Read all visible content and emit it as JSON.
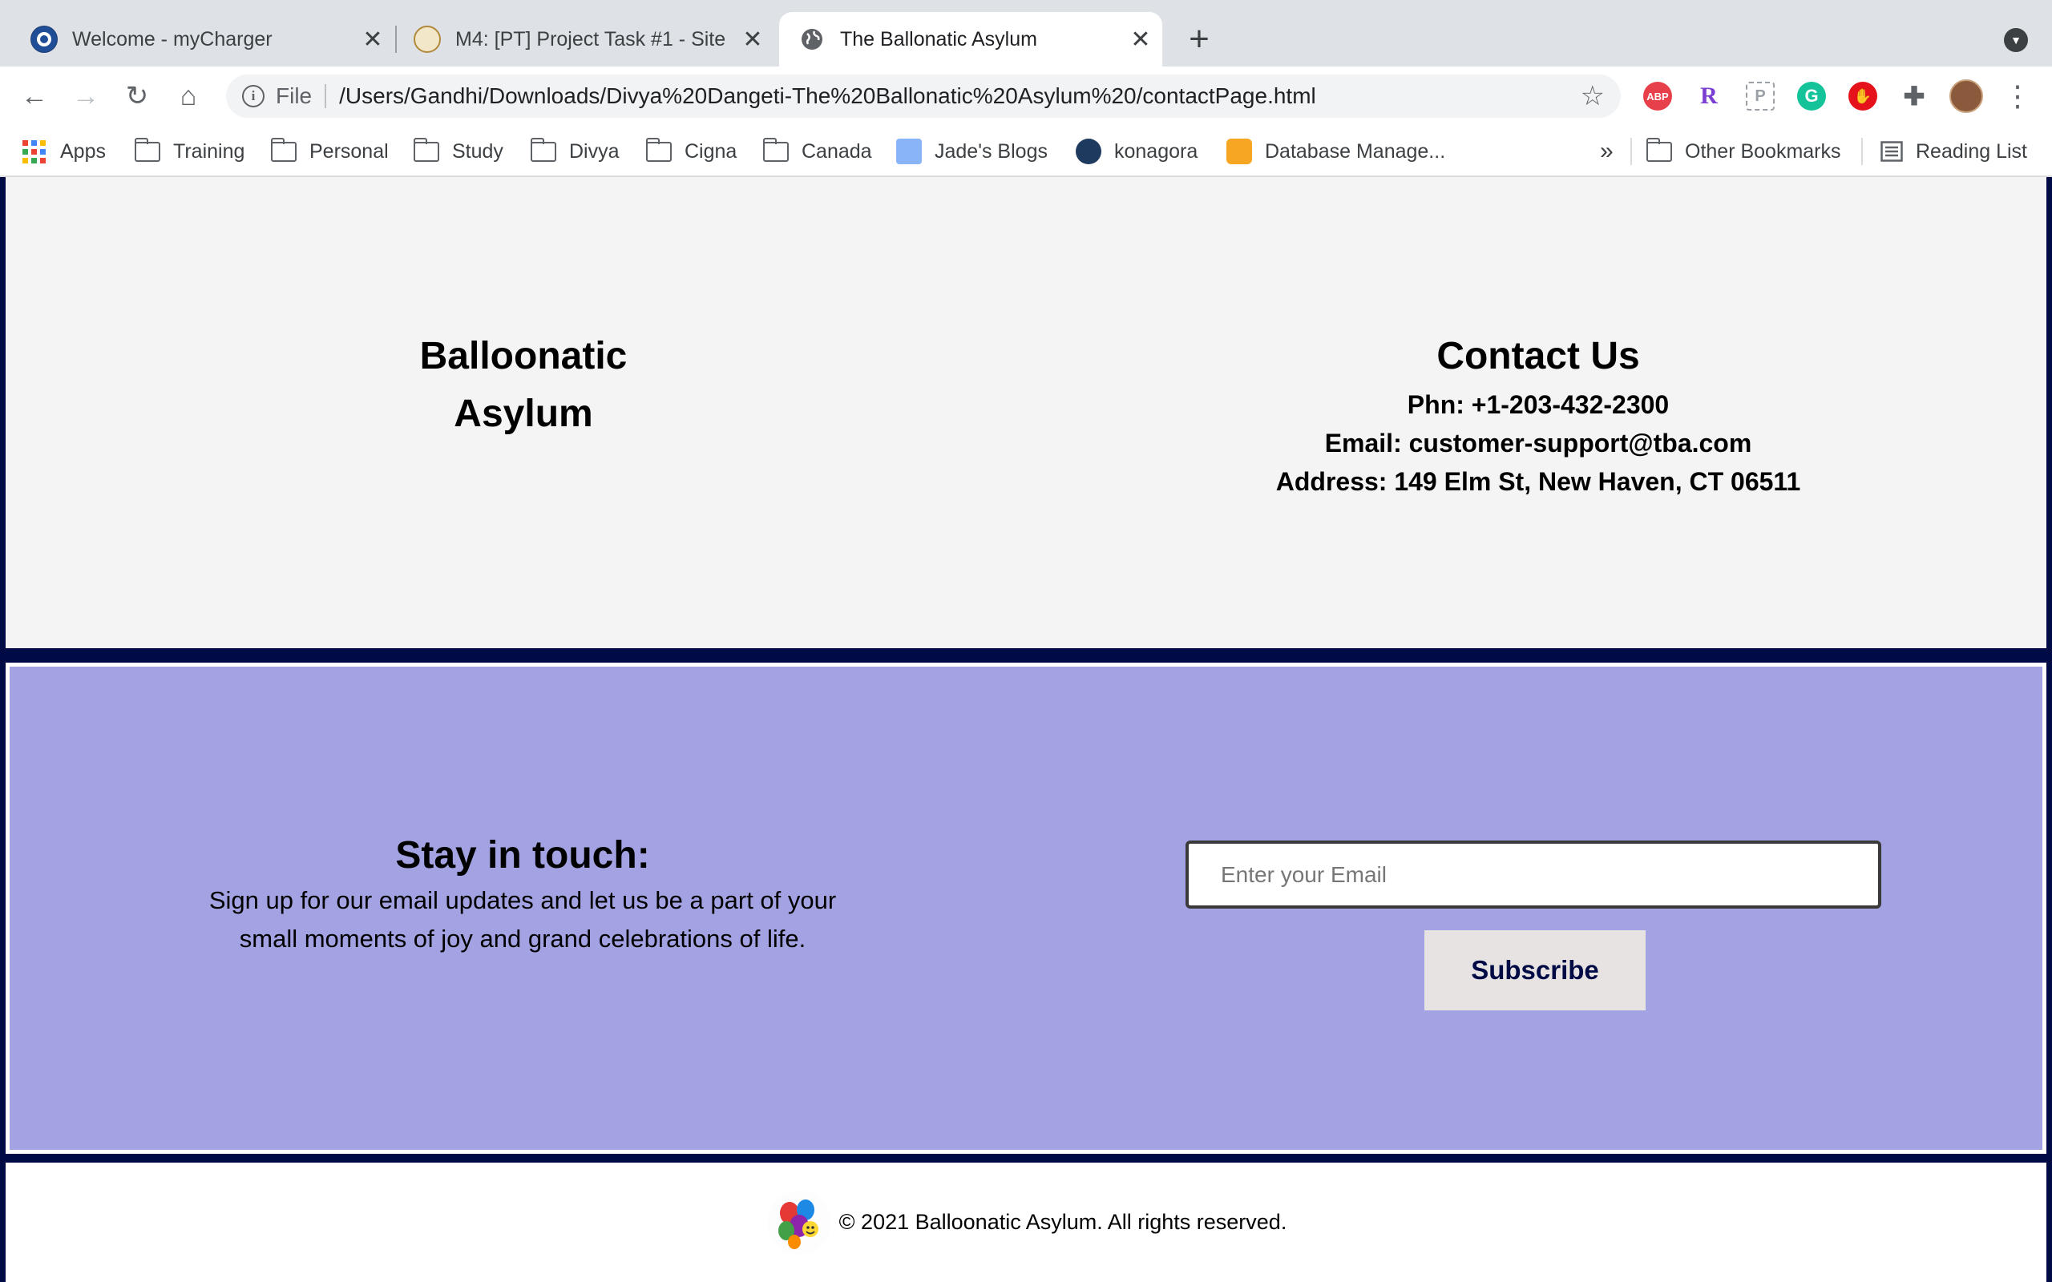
{
  "browser": {
    "tabs": [
      {
        "title": "Welcome - myCharger",
        "active": false
      },
      {
        "title": "M4: [PT] Project Task #1 - Site",
        "active": false
      },
      {
        "title": "The Ballonatic Asylum",
        "active": true
      }
    ],
    "new_tab_symbol": "+",
    "address_scheme": "File",
    "address_url": "/Users/Gandhi/Downloads/Divya%20Dangeti-The%20Ballonatic%20Asylum%20/contactPage.html",
    "extensions": [
      {
        "name": "adblock-plus",
        "label": "ABP",
        "color": "#e7404a"
      },
      {
        "name": "r-extension",
        "label": "R",
        "color": "#7b3fd1"
      },
      {
        "name": "p-extension",
        "label": "P",
        "color": "#9aa0a6"
      },
      {
        "name": "grammarly",
        "label": "G",
        "color": "#15c39a"
      },
      {
        "name": "adblock",
        "label": "✋",
        "color": "#e5121c"
      }
    ],
    "bookmarks": [
      {
        "label": "Apps",
        "icon": "apps-grid-icon"
      },
      {
        "label": "Training",
        "icon": "folder-icon"
      },
      {
        "label": "Personal",
        "icon": "folder-icon"
      },
      {
        "label": "Study",
        "icon": "folder-icon"
      },
      {
        "label": "Divya",
        "icon": "folder-icon"
      },
      {
        "label": "Cigna",
        "icon": "folder-icon"
      },
      {
        "label": "Canada",
        "icon": "folder-icon"
      },
      {
        "label": "Jade's Blogs",
        "icon": "blog-icon"
      },
      {
        "label": "konagora",
        "icon": "konagora-icon"
      },
      {
        "label": "Database Manage...",
        "icon": "database-icon"
      }
    ],
    "bookmarks_overflow": "»",
    "other_bookmarks": "Other Bookmarks",
    "reading_list": "Reading List"
  },
  "page": {
    "brand_line1": "Balloonatic",
    "brand_line2": "Asylum",
    "contact": {
      "heading": "Contact Us",
      "phone": "Phn: +1-203-432-2300",
      "email": "Email: customer-support@tba.com",
      "address": "Address: 149 Elm St, New Haven, CT 06511"
    },
    "subscribe": {
      "heading": "Stay in touch:",
      "text": "Sign up for our email updates and let us be a part of your small moments of joy and grand celebrations of life.",
      "placeholder": "Enter your Email",
      "button": "Subscribe"
    },
    "footer": {
      "text": "© 2021 Balloonatic Asylum. All rights reserved."
    }
  },
  "colors": {
    "page_frame": "#000b45",
    "subscribe_bg": "#a3a3e3",
    "button_text": "#000b45"
  }
}
